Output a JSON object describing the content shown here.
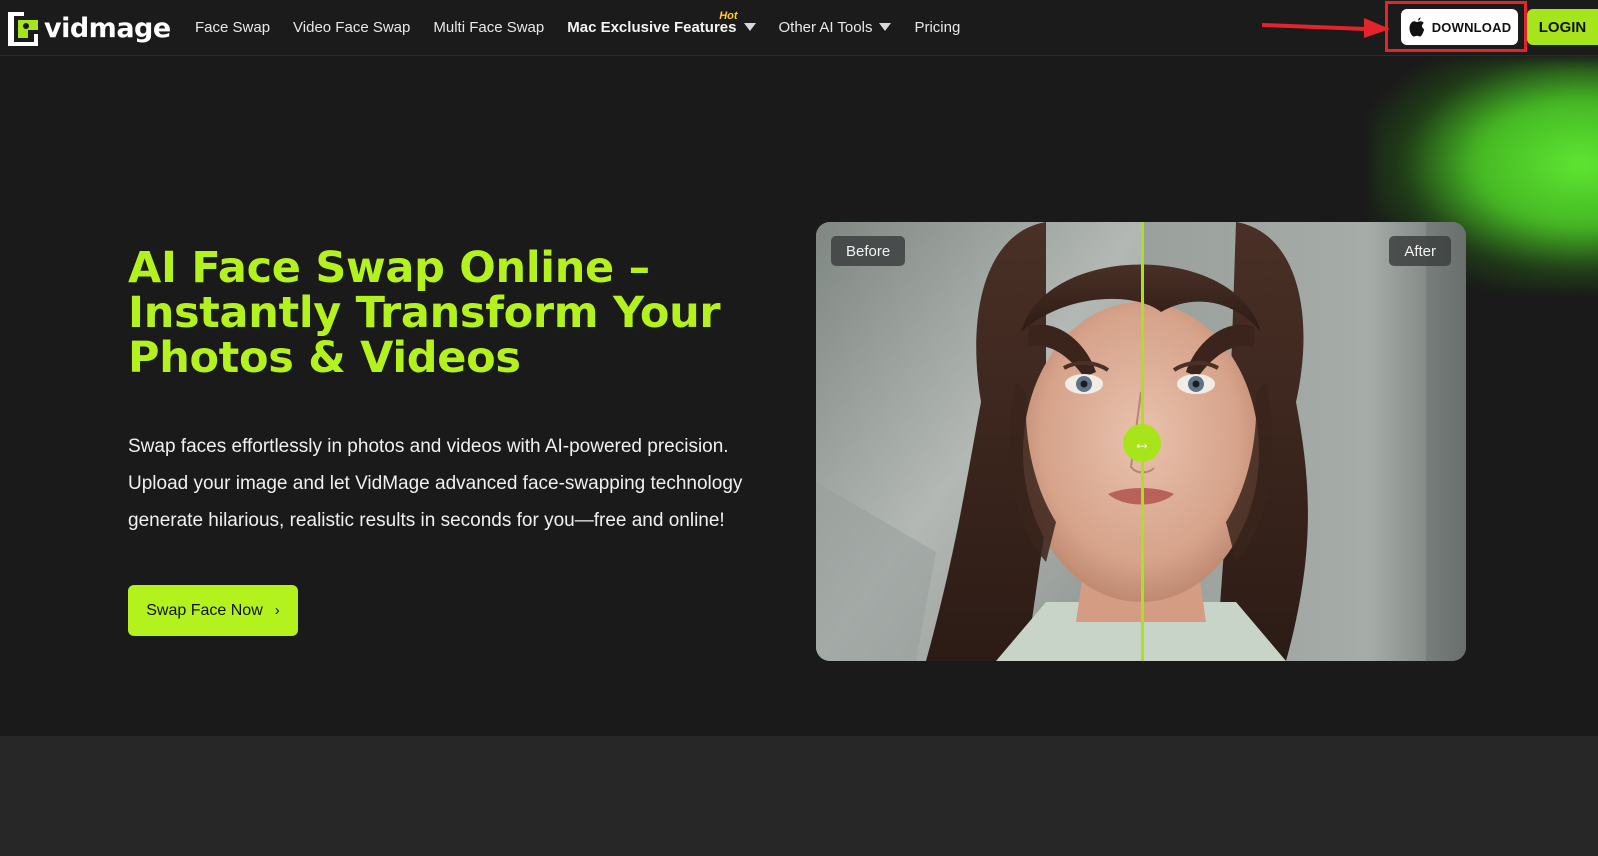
{
  "brand": {
    "name": "vidmage"
  },
  "nav": {
    "items": [
      {
        "label": "Face Swap"
      },
      {
        "label": "Video Face Swap"
      },
      {
        "label": "Multi Face Swap"
      },
      {
        "label": "Mac Exclusive Features",
        "badge": "Hot",
        "dropdown": true
      },
      {
        "label": "Other AI Tools",
        "dropdown": true
      },
      {
        "label": "Pricing"
      }
    ]
  },
  "header": {
    "download_label": "DOWNLOAD",
    "login_label": "LOGIN"
  },
  "hero": {
    "title": "AI Face Swap Online – Instantly Transform Your Photos & Videos",
    "description": "Swap faces effortlessly in photos and videos with AI-powered precision. Upload your image and let VidMage advanced face-swapping technology generate hilarious, realistic results in seconds for you—free and online!",
    "cta_label": "Swap Face Now",
    "cta_chevron": "›"
  },
  "compare": {
    "before_label": "Before",
    "after_label": "After",
    "handle_glyph": "↔",
    "split_fraction": 0.5
  },
  "colors": {
    "accent": "#b4f21e",
    "background": "#1a1a1a",
    "highlight": "#e3242b",
    "hot": "#ffcc33"
  }
}
